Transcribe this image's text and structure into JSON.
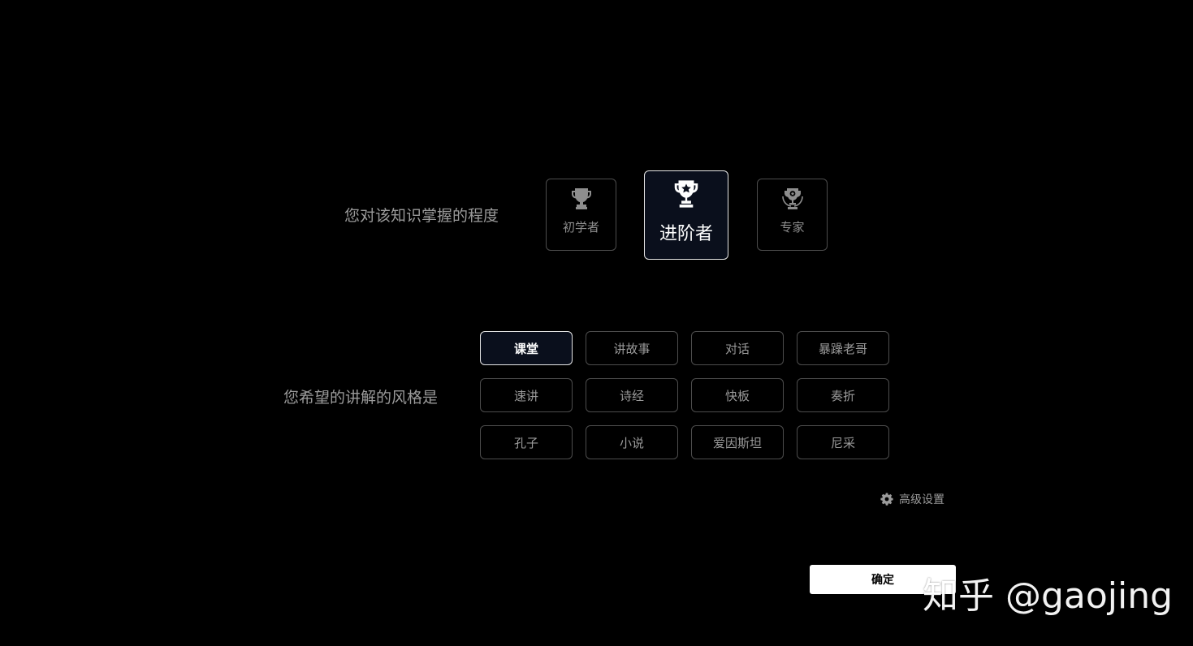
{
  "level_question": "您对该知识掌握的程度",
  "levels": [
    {
      "label": "初学者",
      "icon": "trophy-icon",
      "selected": false
    },
    {
      "label": "进阶者",
      "icon": "trophy-star-icon",
      "selected": true
    },
    {
      "label": "专家",
      "icon": "trophy-laurel-icon",
      "selected": false
    }
  ],
  "style_question": "您希望的讲解的风格是",
  "styles": [
    {
      "label": "课堂",
      "selected": true
    },
    {
      "label": "讲故事",
      "selected": false
    },
    {
      "label": "对话",
      "selected": false
    },
    {
      "label": "暴躁老哥",
      "selected": false
    },
    {
      "label": "速讲",
      "selected": false
    },
    {
      "label": "诗经",
      "selected": false
    },
    {
      "label": "快板",
      "selected": false
    },
    {
      "label": "奏折",
      "selected": false
    },
    {
      "label": "孔子",
      "selected": false
    },
    {
      "label": "小说",
      "selected": false
    },
    {
      "label": "爱因斯坦",
      "selected": false
    },
    {
      "label": "尼采",
      "selected": false
    }
  ],
  "advanced_settings": {
    "label": "高级设置",
    "icon": "gear-icon"
  },
  "confirm_label": "确定",
  "watermark": "知乎 @gaojing",
  "colors": {
    "background": "#000000",
    "selected_bg": "#0a0f1c",
    "selected_border": "#e6e6e6",
    "border": "#4d4d4d",
    "text": "#9a9a9a"
  }
}
